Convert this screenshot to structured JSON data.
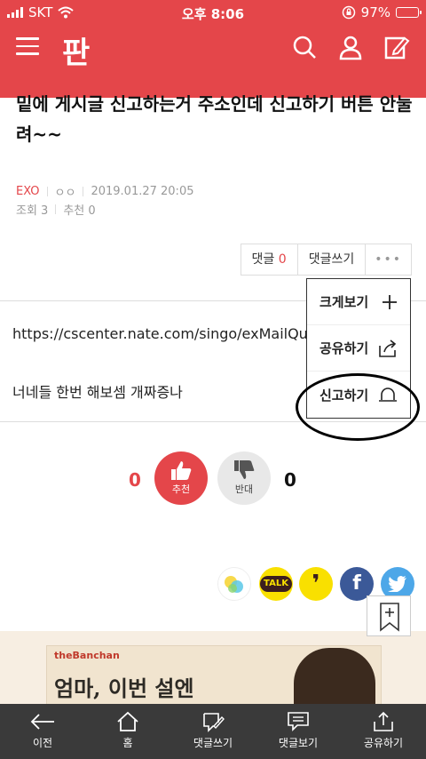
{
  "status": {
    "carrier": "SKT",
    "time": "오후 8:06",
    "battery": "97%",
    "battery_level": 0.97
  },
  "header": {
    "logo": "판",
    "brand_color": "#e4464a"
  },
  "article": {
    "title": "밑에 게시글 신고하는거 주소인데 신고하기 버튼 안눌려~~",
    "category": "EXO",
    "author": "ㅇㅇ",
    "datetime": "2019.01.27 20:05",
    "views": "조회 3",
    "recommends": "추천 0",
    "url_line": "https://cscenter.nate.com/singo/exMailQues",
    "text_line": "너네들 한번 해보셈 개짜증나"
  },
  "actions": {
    "comments_label": "댓글",
    "comments_count": "0",
    "write_comment": "댓글쓰기",
    "more": "•••"
  },
  "dropdown": {
    "items": [
      {
        "label": "크게보기"
      },
      {
        "label": "공유하기"
      },
      {
        "label": "신고하기"
      }
    ]
  },
  "votes": {
    "up_count": "0",
    "up_label": "추천",
    "down_label": "반대",
    "down_count": "0"
  },
  "share": {
    "kakaotalk": "TALK",
    "kakaostory": "❜",
    "facebook": "f"
  },
  "ad": {
    "brand": "theBanchan",
    "copy": "엄마, 이번 설엔"
  },
  "tabbar": {
    "items": [
      {
        "label": "이전"
      },
      {
        "label": "홈"
      },
      {
        "label": "댓글쓰기"
      },
      {
        "label": "댓글보기"
      },
      {
        "label": "공유하기"
      }
    ]
  }
}
